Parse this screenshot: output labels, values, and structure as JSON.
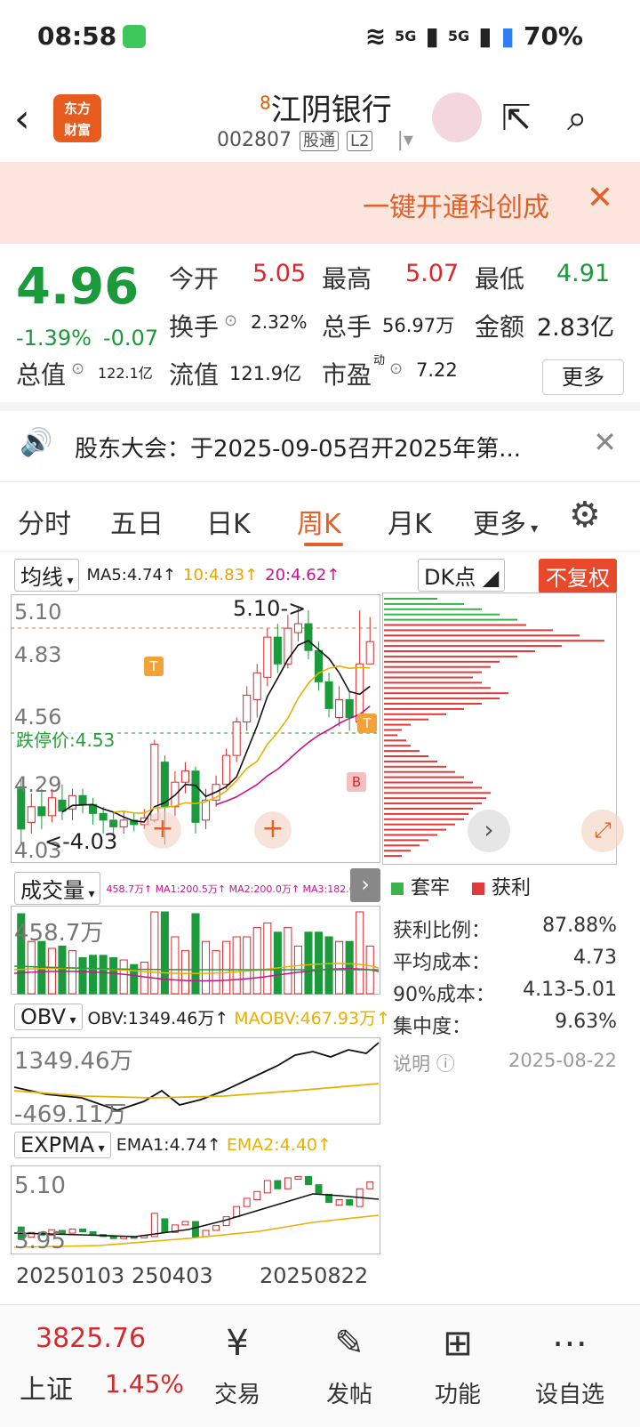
{
  "status": {
    "time": "08:58",
    "net1": "5G",
    "net2": "5G",
    "battery": "70%"
  },
  "header": {
    "logo_line1": "东方",
    "logo_line2": "财富",
    "badge": "8",
    "name": "江阴银行",
    "code": "002807",
    "tag1": "股通",
    "tag2": "L2"
  },
  "banner": {
    "text": "一键开通科创成"
  },
  "quote": {
    "price": "4.96",
    "pct": "-1.39%",
    "chg": "-0.07",
    "open_l": "今开",
    "open": "5.05",
    "high_l": "最高",
    "high": "5.07",
    "low_l": "最低",
    "low": "4.91",
    "turn_l": "换手",
    "turn": "2.32%",
    "vol_l": "总手",
    "vol": "56.97万",
    "amt_l": "金额",
    "amt": "2.83亿",
    "cap_l": "总值",
    "cap": "122.1亿",
    "float_l": "流值",
    "float": "121.9亿",
    "pe_l": "市盈",
    "pe_sup": "动",
    "pe": "7.22",
    "more": "更多"
  },
  "notice": {
    "text": "股东大会：于2025-09-05召开2025年第..."
  },
  "tabs": [
    "分时",
    "五日",
    "日K",
    "周K",
    "月K",
    "更多"
  ],
  "main_chart": {
    "ma_select": "均线",
    "ma5": "MA5:4.74↑",
    "ma10": "10:4.83↑",
    "ma20": "20:4.62↑",
    "dk": "DK点",
    "fq": "不复权",
    "y_top": "5.10",
    "y2": "4.83",
    "y3": "4.56",
    "y4": "4.29",
    "y_bottom": "4.03",
    "high_mark": "5.10->",
    "low_mark": "<-4.03",
    "limit": "跌停价:4.53",
    "mark_t": "T",
    "mark_b": "B"
  },
  "volume": {
    "select": "成交量",
    "legend": "458.7万↑ MA1:200.5万↑ MA2:200.0万↑ MA3:182.6万↑",
    "top": "458.7万"
  },
  "obv": {
    "select": "OBV",
    "obv": "OBV:1349.46万↑",
    "maobv": "MAOBV:467.93万↑",
    "top": "1349.46万",
    "bottom": "-469.11万"
  },
  "expma": {
    "select": "EXPMA",
    "ema1": "EMA1:4.74↑",
    "ema2": "EMA2:4.40↑",
    "top": "5.10",
    "bottom": "3.95"
  },
  "dates": {
    "d1": "20250103",
    "d2": "250403",
    "d3": "20250822"
  },
  "cost": {
    "legend_trap": "套牢",
    "legend_profit": "获利",
    "rows": [
      {
        "label": "获利比例：",
        "value": "87.88%"
      },
      {
        "label": "平均成本：",
        "value": "4.73"
      },
      {
        "label": "90%成本：",
        "value": "4.13-5.01"
      },
      {
        "label": "集中度：",
        "value": "9.63%"
      }
    ],
    "note": "说明",
    "date": "2025-08-22"
  },
  "bottom": {
    "index_value": "3825.76",
    "index_name": "上证",
    "index_pct": "1.45%",
    "items": [
      "交易",
      "发帖",
      "功能",
      "设自选"
    ]
  },
  "candles": [
    {
      "o": 4.3,
      "c": 4.12,
      "h": 4.35,
      "l": 4.05
    },
    {
      "o": 4.15,
      "c": 4.22,
      "h": 4.28,
      "l": 4.1
    },
    {
      "o": 4.22,
      "c": 4.18,
      "h": 4.3,
      "l": 4.12
    },
    {
      "o": 4.18,
      "c": 4.26,
      "h": 4.3,
      "l": 4.15
    },
    {
      "o": 4.25,
      "c": 4.2,
      "h": 4.32,
      "l": 4.16
    },
    {
      "o": 4.21,
      "c": 4.27,
      "h": 4.3,
      "l": 4.16
    },
    {
      "o": 4.27,
      "c": 4.23,
      "h": 4.3,
      "l": 4.19
    },
    {
      "o": 4.23,
      "c": 4.19,
      "h": 4.26,
      "l": 4.14
    },
    {
      "o": 4.19,
      "c": 4.16,
      "h": 4.22,
      "l": 4.1
    },
    {
      "o": 4.16,
      "c": 4.13,
      "h": 4.2,
      "l": 4.09
    },
    {
      "o": 4.13,
      "c": 4.16,
      "h": 4.2,
      "l": 4.1
    },
    {
      "o": 4.16,
      "c": 4.14,
      "h": 4.19,
      "l": 4.11
    },
    {
      "o": 4.14,
      "c": 4.17,
      "h": 4.21,
      "l": 4.12
    },
    {
      "o": 4.16,
      "c": 4.5,
      "h": 4.52,
      "l": 4.15
    },
    {
      "o": 4.42,
      "c": 4.22,
      "h": 4.45,
      "l": 4.05
    },
    {
      "o": 4.22,
      "c": 4.33,
      "h": 4.38,
      "l": 4.18
    },
    {
      "o": 4.33,
      "c": 4.38,
      "h": 4.42,
      "l": 4.28
    },
    {
      "o": 4.38,
      "c": 4.15,
      "h": 4.4,
      "l": 4.1
    },
    {
      "o": 4.16,
      "c": 4.25,
      "h": 4.3,
      "l": 4.12
    },
    {
      "o": 4.25,
      "c": 4.32,
      "h": 4.36,
      "l": 4.22
    },
    {
      "o": 4.32,
      "c": 4.45,
      "h": 4.48,
      "l": 4.3
    },
    {
      "o": 4.45,
      "c": 4.6,
      "h": 4.62,
      "l": 4.42
    },
    {
      "o": 4.6,
      "c": 4.72,
      "h": 4.76,
      "l": 4.56
    },
    {
      "o": 4.7,
      "c": 4.82,
      "h": 4.86,
      "l": 4.62
    },
    {
      "o": 4.8,
      "c": 4.98,
      "h": 5.02,
      "l": 4.76
    },
    {
      "o": 4.98,
      "c": 4.86,
      "h": 5.04,
      "l": 4.82
    },
    {
      "o": 4.86,
      "c": 5.02,
      "h": 5.08,
      "l": 4.84
    },
    {
      "o": 5.0,
      "c": 5.04,
      "h": 5.12,
      "l": 4.96
    },
    {
      "o": 5.04,
      "c": 4.92,
      "h": 5.1,
      "l": 4.88
    },
    {
      "o": 4.92,
      "c": 4.78,
      "h": 4.96,
      "l": 4.74
    },
    {
      "o": 4.78,
      "c": 4.66,
      "h": 4.82,
      "l": 4.62
    },
    {
      "o": 4.62,
      "c": 4.7,
      "h": 4.76,
      "l": 4.58
    },
    {
      "o": 4.7,
      "c": 4.62,
      "h": 4.74,
      "l": 4.56
    },
    {
      "o": 4.6,
      "c": 4.86,
      "h": 5.1,
      "l": 4.58
    },
    {
      "o": 4.86,
      "c": 4.96,
      "h": 5.07,
      "l": 4.91
    }
  ]
}
